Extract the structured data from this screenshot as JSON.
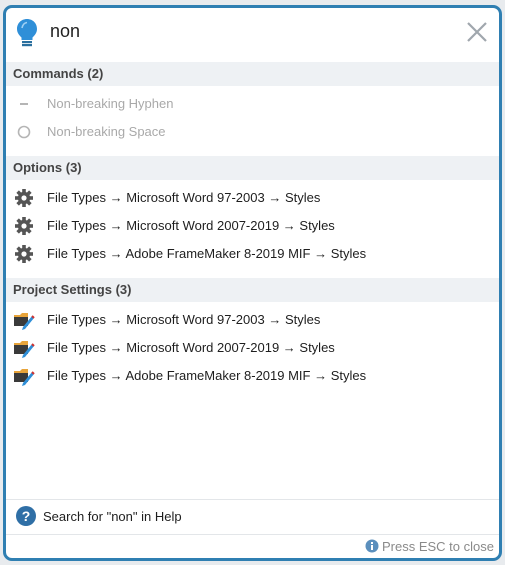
{
  "search": {
    "query": "non"
  },
  "sections": {
    "commands": {
      "title": "Commands",
      "count": "(2)"
    },
    "options": {
      "title": "Options",
      "count": "(3)"
    },
    "project": {
      "title": "Project Settings",
      "count": "(3)"
    }
  },
  "commands": [
    {
      "label": "Non-breaking Hyphen",
      "icon": "hyphen-icon"
    },
    {
      "label": "Non-breaking Space",
      "icon": "space-circle-icon"
    }
  ],
  "options": [
    {
      "label": "File Types → Microsoft Word 97-2003 → Styles",
      "icon": "gear-icon"
    },
    {
      "label": "File Types → Microsoft Word 2007-2019 → Styles",
      "icon": "gear-icon"
    },
    {
      "label": "File Types → Adobe FrameMaker 8-2019 MIF → Styles",
      "icon": "gear-icon"
    }
  ],
  "project": [
    {
      "label": "File Types → Microsoft Word 97-2003 → Styles",
      "icon": "project-settings-icon"
    },
    {
      "label": "File Types → Microsoft Word 2007-2019 → Styles",
      "icon": "project-settings-icon"
    },
    {
      "label": "File Types → Adobe FrameMaker 8-2019 MIF → Styles",
      "icon": "project-settings-icon"
    }
  ],
  "help": {
    "label": "Search for \"non\" in Help",
    "icon": "help-circle-icon"
  },
  "footer": {
    "label": "Press ESC to close",
    "icon": "info-icon"
  },
  "colors": {
    "accent": "#2f7fb2",
    "section_bg": "#eef1f4",
    "disabled_text": "#a9a9a9"
  }
}
